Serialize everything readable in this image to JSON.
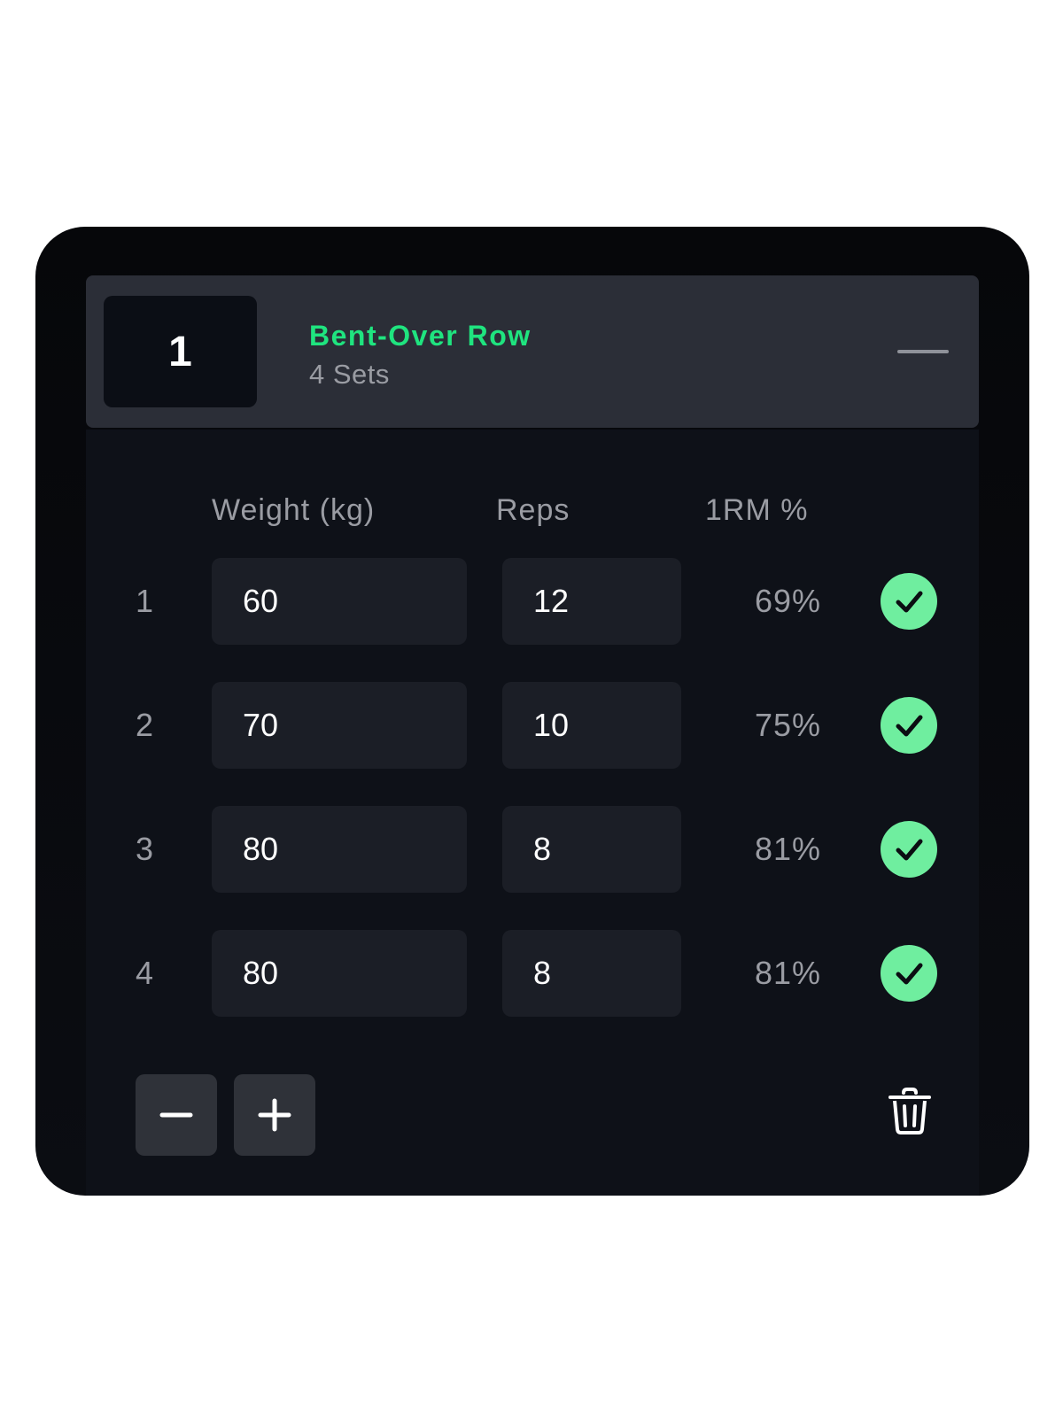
{
  "exercise": {
    "index": "1",
    "name": "Bent-Over Row",
    "sets_label": "4 Sets",
    "accent_color": "#1fe47f"
  },
  "columns": {
    "weight": "Weight (kg)",
    "reps": "Reps",
    "onerm": "1RM %"
  },
  "sets": [
    {
      "number": "1",
      "weight": "60",
      "reps": "12",
      "onerm": "69%",
      "completed": true
    },
    {
      "number": "2",
      "weight": "70",
      "reps": "10",
      "onerm": "75%",
      "completed": true
    },
    {
      "number": "3",
      "weight": "80",
      "reps": "8",
      "onerm": "81%",
      "completed": true
    },
    {
      "number": "4",
      "weight": "80",
      "reps": "8",
      "onerm": "81%",
      "completed": true
    }
  ],
  "icons": {
    "collapse": "minus-icon",
    "complete": "check-icon",
    "remove_set": "minus-icon",
    "add_set": "plus-icon",
    "delete": "trash-icon"
  },
  "colors": {
    "check_fill": "#6fee9f",
    "header_bg": "#2b2e37",
    "field_bg": "#1b1e26"
  }
}
